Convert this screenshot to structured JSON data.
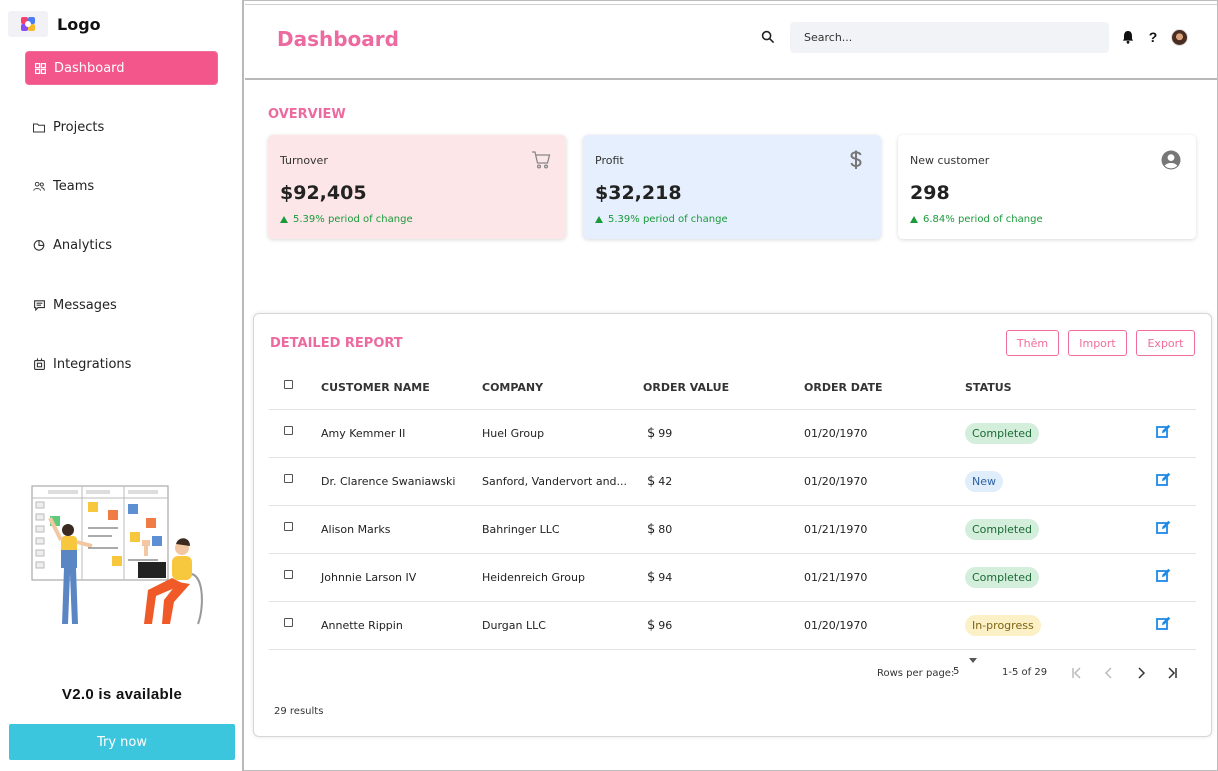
{
  "app": {
    "logo_text": "Logo",
    "brand_color": "#f2568a",
    "accent_pink": "#ec6aa0"
  },
  "sidebar": {
    "items": [
      {
        "label": "Dashboard",
        "icon": "grid-icon",
        "active": true
      },
      {
        "label": "Projects",
        "icon": "folder-icon"
      },
      {
        "label": "Teams",
        "icon": "users-icon"
      },
      {
        "label": "Analytics",
        "icon": "pie-chart-icon"
      },
      {
        "label": "Messages",
        "icon": "message-icon"
      },
      {
        "label": "Integrations",
        "icon": "plug-icon"
      }
    ],
    "promo_title": "V2.0 is available",
    "promo_button": "Try now"
  },
  "header": {
    "title": "Dashboard",
    "search_placeholder": "Search...",
    "icons": [
      "search-icon",
      "bell-icon",
      "help-icon",
      "avatar"
    ]
  },
  "overview": {
    "title": "OVERVIEW",
    "cards": [
      {
        "label": "Turnover",
        "value": "$92,405",
        "change": "5.39% period of change",
        "icon": "cart-icon",
        "bg": "#fde6e8"
      },
      {
        "label": "Profit",
        "value": "$32,218",
        "change": "5.39% period of change",
        "icon": "dollar-icon",
        "bg": "#e6effd"
      },
      {
        "label": "New customer",
        "value": "298",
        "change": "6.84% period of change",
        "icon": "user-circle-icon",
        "bg": "#ffffff"
      }
    ]
  },
  "report": {
    "title": "DETAILED REPORT",
    "buttons": {
      "add": "Thêm",
      "import": "Import",
      "export": "Export"
    },
    "columns": [
      "CUSTOMER NAME",
      "COMPANY",
      "ORDER VALUE",
      "ORDER DATE",
      "STATUS"
    ],
    "rows": [
      {
        "name": "Amy Kemmer II",
        "company": "Huel Group",
        "value": "99",
        "date": "01/20/1970",
        "status": "Completed"
      },
      {
        "name": "Dr. Clarence Swaniawski",
        "company": "Sanford, Vandervort and...",
        "value": "42",
        "date": "01/20/1970",
        "status": "New"
      },
      {
        "name": "Alison Marks",
        "company": "Bahringer LLC",
        "value": "80",
        "date": "01/21/1970",
        "status": "Completed"
      },
      {
        "name": "Johnnie Larson IV",
        "company": "Heidenreich Group",
        "value": "94",
        "date": "01/21/1970",
        "status": "Completed"
      },
      {
        "name": "Annette Rippin",
        "company": "Durgan LLC",
        "value": "96",
        "date": "01/20/1970",
        "status": "In-progress"
      }
    ],
    "currency_symbol": "$",
    "pagination": {
      "rows_per_page_label": "Rows per page:",
      "rows_per_page": "5",
      "range": "1-5 of 29"
    },
    "results_text": "29 results"
  }
}
